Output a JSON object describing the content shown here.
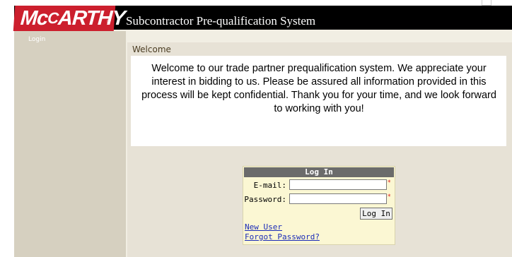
{
  "brand": {
    "logo_text": "McCARTHY",
    "registered_mark": "®"
  },
  "header": {
    "app_title": "Subcontractor Pre-qualification System"
  },
  "sidebar": {
    "login_link": "Login"
  },
  "welcome": {
    "title": "Welcome",
    "message": "Welcome to our trade partner prequalification system. We appreciate your interest in bidding to us. Please be assured all information provided in this process will be kept confidential. Thank you for your time, and we look forward to working with you!"
  },
  "login": {
    "heading": "Log In",
    "email_label": "E-mail:",
    "password_label": "Password:",
    "email_value": "",
    "password_value": "",
    "required_mark": "*",
    "submit_label": "Log In",
    "new_user_link": "New User",
    "forgot_password_link": "Forgot Password?"
  },
  "colors": {
    "brand_red": "#cc1f2d",
    "header_black": "#000000",
    "sidebar_tan": "#d6d0c0",
    "panel_beige": "#e7e2d6",
    "login_box_yellow": "#fbf7d3",
    "link_blue": "#1a2bb8"
  }
}
